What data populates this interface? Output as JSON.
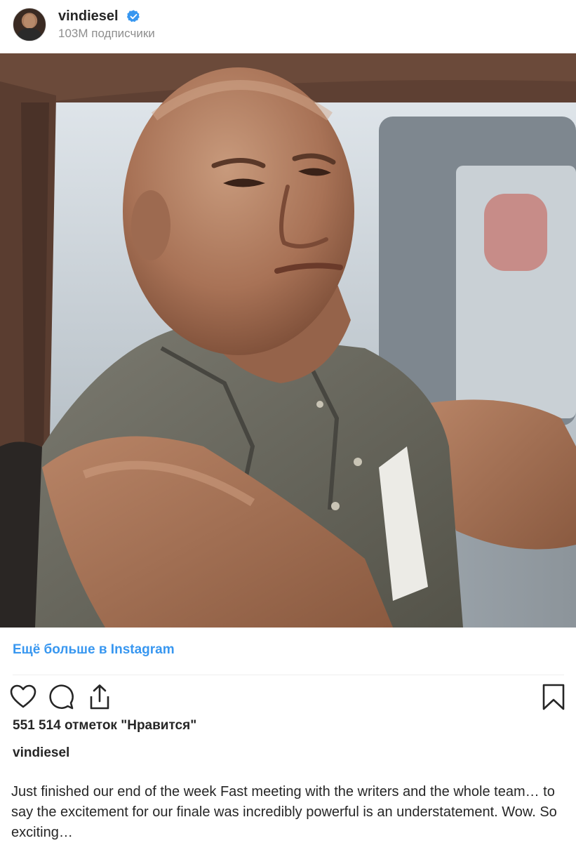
{
  "header": {
    "username": "vindiesel",
    "followers": "103M подписчики",
    "verified": true
  },
  "post": {
    "image_alt": "photo-man-in-car",
    "more_link": "Ещё больше в Instagram",
    "likes": "551 514 отметок \"Нравится\"",
    "author": "vindiesel",
    "caption": "Just finished our end of the week Fast meeting with the writers and the whole team… to say the excitement for our finale was incredibly powerful is an understatement. Wow. So exciting…"
  },
  "icons": {
    "like": "heart-icon",
    "comment": "comment-bubble-icon",
    "share": "share-upload-icon",
    "save": "bookmark-icon",
    "verified": "verified-badge-icon"
  },
  "colors": {
    "link": "#3897f0",
    "verified": "#3897f0",
    "text": "#262626",
    "muted": "#8e8e8e"
  }
}
